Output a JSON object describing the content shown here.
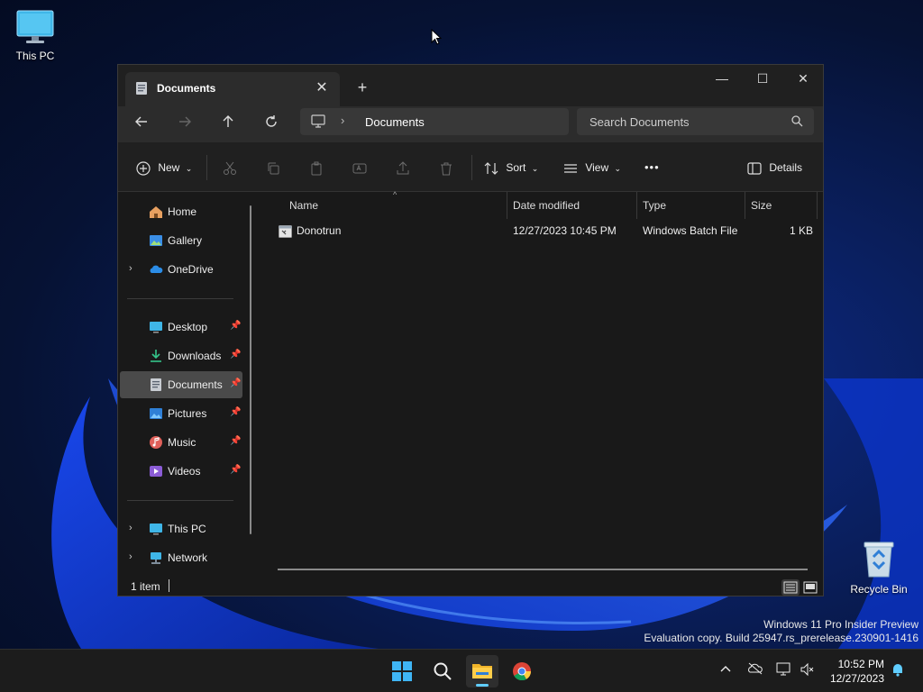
{
  "desktop": {
    "icons": [
      {
        "label": "This PC"
      },
      {
        "label": "Recycle Bin"
      }
    ],
    "watermark_line1": "Windows 11 Pro Insider Preview",
    "watermark_line2": "Evaluation copy. Build 25947.rs_prerelease.230901-1416"
  },
  "window": {
    "tab_title": "Documents",
    "close_tab": "✕",
    "new_tab": "+",
    "controls": {
      "minimize": "—",
      "maximize": "☐",
      "close": "✕"
    }
  },
  "address": {
    "breadcrumb": [
      "Documents"
    ],
    "search_placeholder": "Search Documents"
  },
  "commandbar": {
    "new_label": "New",
    "sort_label": "Sort",
    "view_label": "View",
    "more_label": "•••",
    "details_label": "Details"
  },
  "sidebar": {
    "items": [
      {
        "label": "Home"
      },
      {
        "label": "Gallery"
      },
      {
        "label": "OneDrive"
      },
      {
        "label": "Desktop"
      },
      {
        "label": "Downloads"
      },
      {
        "label": "Documents"
      },
      {
        "label": "Pictures"
      },
      {
        "label": "Music"
      },
      {
        "label": "Videos"
      },
      {
        "label": "This PC"
      },
      {
        "label": "Network"
      }
    ]
  },
  "table": {
    "columns": [
      "Name",
      "Date modified",
      "Type",
      "Size"
    ],
    "rows": [
      {
        "name": "Donotrun",
        "date": "12/27/2023 10:45 PM",
        "type": "Windows Batch File",
        "size": "1 KB"
      }
    ]
  },
  "status": {
    "count": "1 item"
  },
  "taskbar": {
    "time": "10:52 PM",
    "date": "12/27/2023"
  },
  "colors": {
    "accent": "#60cdff",
    "window_bg": "#191919",
    "selected": "#4a4a4a"
  }
}
